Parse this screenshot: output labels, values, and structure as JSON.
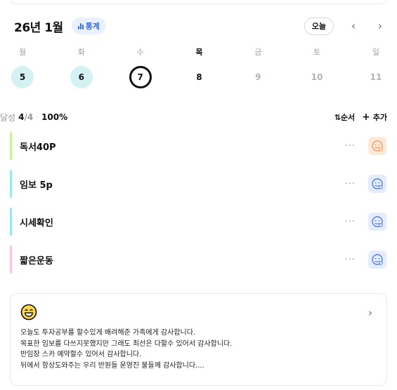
{
  "header": {
    "title": "26년 1월",
    "stats_label": "통계",
    "today_label": "오늘",
    "prev_icon": "chevron-left-icon",
    "next_icon": "chevron-right-icon"
  },
  "week": {
    "days": [
      "월",
      "화",
      "수",
      "목",
      "금",
      "토",
      "일"
    ],
    "dates": [
      "5",
      "6",
      "7",
      "8",
      "9",
      "10",
      "11"
    ],
    "states": [
      "done",
      "done",
      "today",
      "current",
      "future",
      "future",
      "future"
    ]
  },
  "summary": {
    "label": "달성",
    "done": "4",
    "total": "/4",
    "percent": "100%",
    "order_label": "순서",
    "order_icon": "sort-icon",
    "add_label": "추가",
    "add_icon": "plus-icon"
  },
  "tasks": [
    {
      "name": "독서40P",
      "bar_color": "#c9ef9d",
      "face": "orange"
    },
    {
      "name": "임보 5p",
      "bar_color": "#9fe6ef",
      "face": "blue"
    },
    {
      "name": "시세확인",
      "bar_color": "#9fe6ef",
      "face": "blue"
    },
    {
      "name": "짧은운동",
      "bar_color": "#f8c6de",
      "face": "blue"
    }
  ],
  "more_label": "···",
  "diary": {
    "emoji": "grinning-face-icon",
    "lines": [
      "오늘도 투자공부를 할수있게 배려해준 가족에게 감사합니다.",
      "목표한 임보를 다쓰지못했지만 그래도 최선은 다할수 있어서 감사합니다.",
      "반임장 스카 예약할수 있어서 감사합니다.",
      "뒤에서 항상도와주는 우리 반원들 운영진 불들께 감사합니다...."
    ]
  },
  "colors": {
    "accent_blue": "#3b6fe0",
    "done_date_bg": "#d4f1f4",
    "face_orange": "#f0a063",
    "face_blue": "#5b7fd6"
  }
}
